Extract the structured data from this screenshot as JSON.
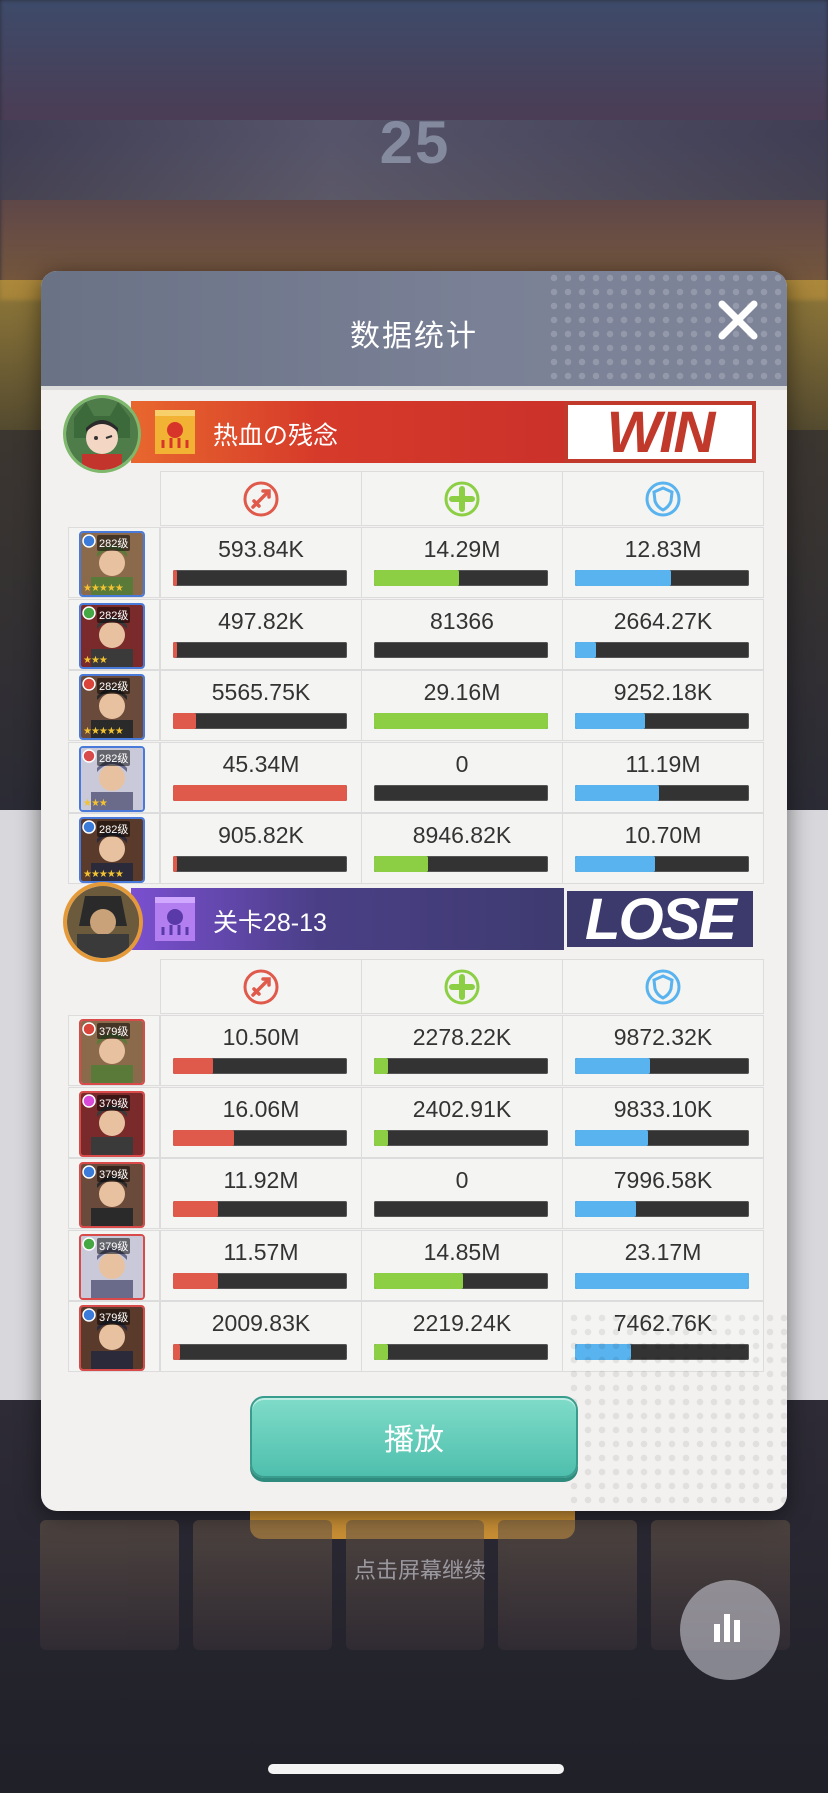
{
  "background": {
    "score": "25",
    "continue_text": "点击屏幕继续"
  },
  "modal": {
    "title": "数据统计",
    "play_button": "播放"
  },
  "colors": {
    "damage": "#e05a4c",
    "heal": "#8ccf45",
    "shield": "#59b3ee",
    "win": "#c0392b",
    "lose": "#3c3a6c"
  },
  "teams": [
    {
      "name": "热血の残念",
      "result": "WIN",
      "heroes": [
        {
          "level": "282级",
          "stars": "★★★★★",
          "damage": "593.84K",
          "damage_pct": 0.02,
          "heal": "14.29M",
          "heal_pct": 0.49,
          "shield": "12.83M",
          "shield_pct": 0.55
        },
        {
          "level": "282级",
          "stars": "★★★",
          "damage": "497.82K",
          "damage_pct": 0.02,
          "heal": "81366",
          "heal_pct": 0.0,
          "shield": "2664.27K",
          "shield_pct": 0.12
        },
        {
          "level": "282级",
          "stars": "★★★★★",
          "damage": "5565.75K",
          "damage_pct": 0.13,
          "heal": "29.16M",
          "heal_pct": 1.0,
          "shield": "9252.18K",
          "shield_pct": 0.4
        },
        {
          "level": "282级",
          "stars": "★★★",
          "damage": "45.34M",
          "damage_pct": 1.0,
          "heal": "0",
          "heal_pct": 0.0,
          "shield": "11.19M",
          "shield_pct": 0.48
        },
        {
          "level": "282级",
          "stars": "★★★★★",
          "damage": "905.82K",
          "damage_pct": 0.02,
          "heal": "8946.82K",
          "heal_pct": 0.31,
          "shield": "10.70M",
          "shield_pct": 0.46
        }
      ]
    },
    {
      "name": "关卡28-13",
      "result": "LOSE",
      "heroes": [
        {
          "level": "379级",
          "damage": "10.50M",
          "damage_pct": 0.23,
          "heal": "2278.22K",
          "heal_pct": 0.08,
          "shield": "9872.32K",
          "shield_pct": 0.43
        },
        {
          "level": "379级",
          "damage": "16.06M",
          "damage_pct": 0.35,
          "heal": "2402.91K",
          "heal_pct": 0.08,
          "shield": "9833.10K",
          "shield_pct": 0.42
        },
        {
          "level": "379级",
          "damage": "11.92M",
          "damage_pct": 0.26,
          "heal": "0",
          "heal_pct": 0.0,
          "shield": "7996.58K",
          "shield_pct": 0.35
        },
        {
          "level": "379级",
          "damage": "11.57M",
          "damage_pct": 0.26,
          "heal": "14.85M",
          "heal_pct": 0.51,
          "shield": "23.17M",
          "shield_pct": 1.0
        },
        {
          "level": "379级",
          "damage": "2009.83K",
          "damage_pct": 0.04,
          "heal": "2219.24K",
          "heal_pct": 0.08,
          "shield": "7462.76K",
          "shield_pct": 0.32
        }
      ]
    }
  ]
}
